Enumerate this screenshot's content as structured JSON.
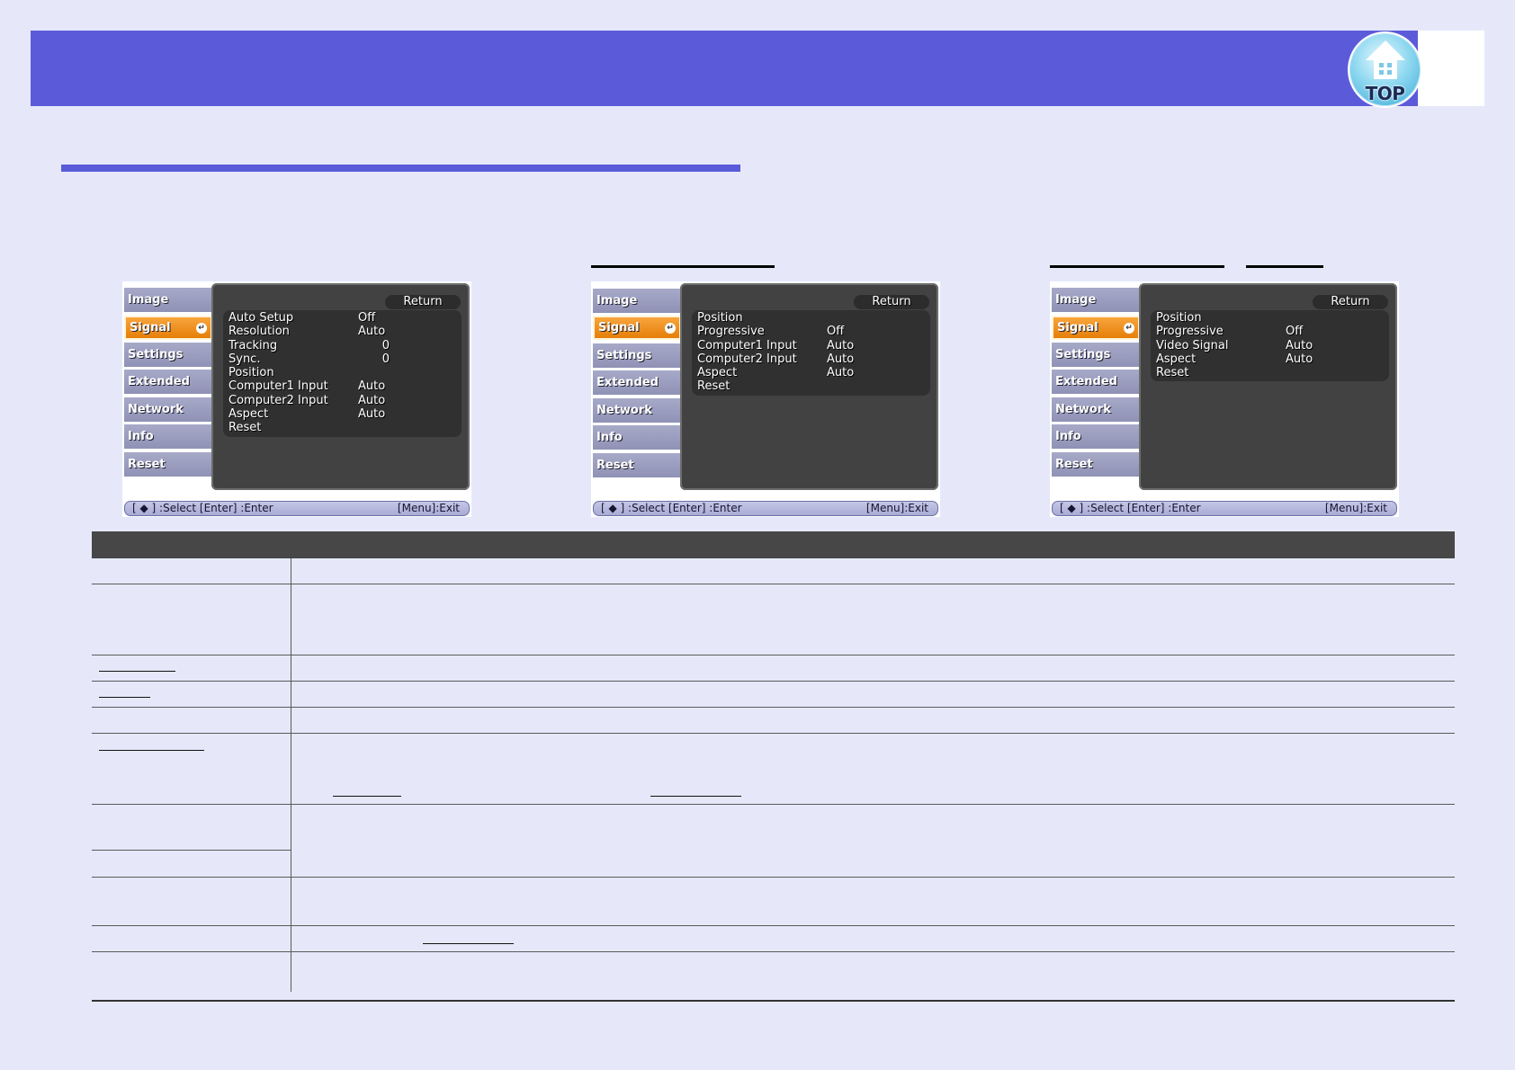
{
  "top_button": {
    "label": "TOP"
  },
  "osd_menus": [
    {
      "tabs": [
        "Image",
        "Signal",
        "Settings",
        "Extended",
        "Network",
        "Info",
        "Reset"
      ],
      "active_tab": "Signal",
      "return_label": "Return",
      "items": [
        {
          "label": "Auto Setup",
          "value": "Off"
        },
        {
          "label": "Resolution",
          "value": "Auto"
        },
        {
          "label": "Tracking",
          "value": "0"
        },
        {
          "label": "Sync.",
          "value": "0"
        },
        {
          "label": "Position",
          "value": ""
        },
        {
          "label": "Computer1 Input",
          "value": "Auto"
        },
        {
          "label": "Computer2 Input",
          "value": "Auto"
        },
        {
          "label": "Aspect",
          "value": "Auto"
        },
        {
          "label": "Reset",
          "value": ""
        }
      ],
      "footer_left": "[ ◆ ] :Select  [Enter] :Enter",
      "footer_right": "[Menu]:Exit"
    },
    {
      "tabs": [
        "Image",
        "Signal",
        "Settings",
        "Extended",
        "Network",
        "Info",
        "Reset"
      ],
      "active_tab": "Signal",
      "return_label": "Return",
      "items": [
        {
          "label": "Position",
          "value": ""
        },
        {
          "label": "Progressive",
          "value": "Off"
        },
        {
          "label": "Computer1 Input",
          "value": "Auto"
        },
        {
          "label": "Computer2 Input",
          "value": "Auto"
        },
        {
          "label": "Aspect",
          "value": "Auto"
        },
        {
          "label": "Reset",
          "value": ""
        }
      ],
      "footer_left": "[ ◆ ] :Select  [Enter] :Enter",
      "footer_right": "[Menu]:Exit"
    },
    {
      "tabs": [
        "Image",
        "Signal",
        "Settings",
        "Extended",
        "Network",
        "Info",
        "Reset"
      ],
      "active_tab": "Signal",
      "return_label": "Return",
      "items": [
        {
          "label": "Position",
          "value": ""
        },
        {
          "label": "Progressive",
          "value": "Off"
        },
        {
          "label": "Video Signal",
          "value": "Auto"
        },
        {
          "label": "Aspect",
          "value": "Auto"
        },
        {
          "label": "Reset",
          "value": ""
        }
      ],
      "footer_left": "[ ◆ ] :Select  [Enter] :Enter",
      "footer_right": "[Menu]:Exit"
    }
  ]
}
